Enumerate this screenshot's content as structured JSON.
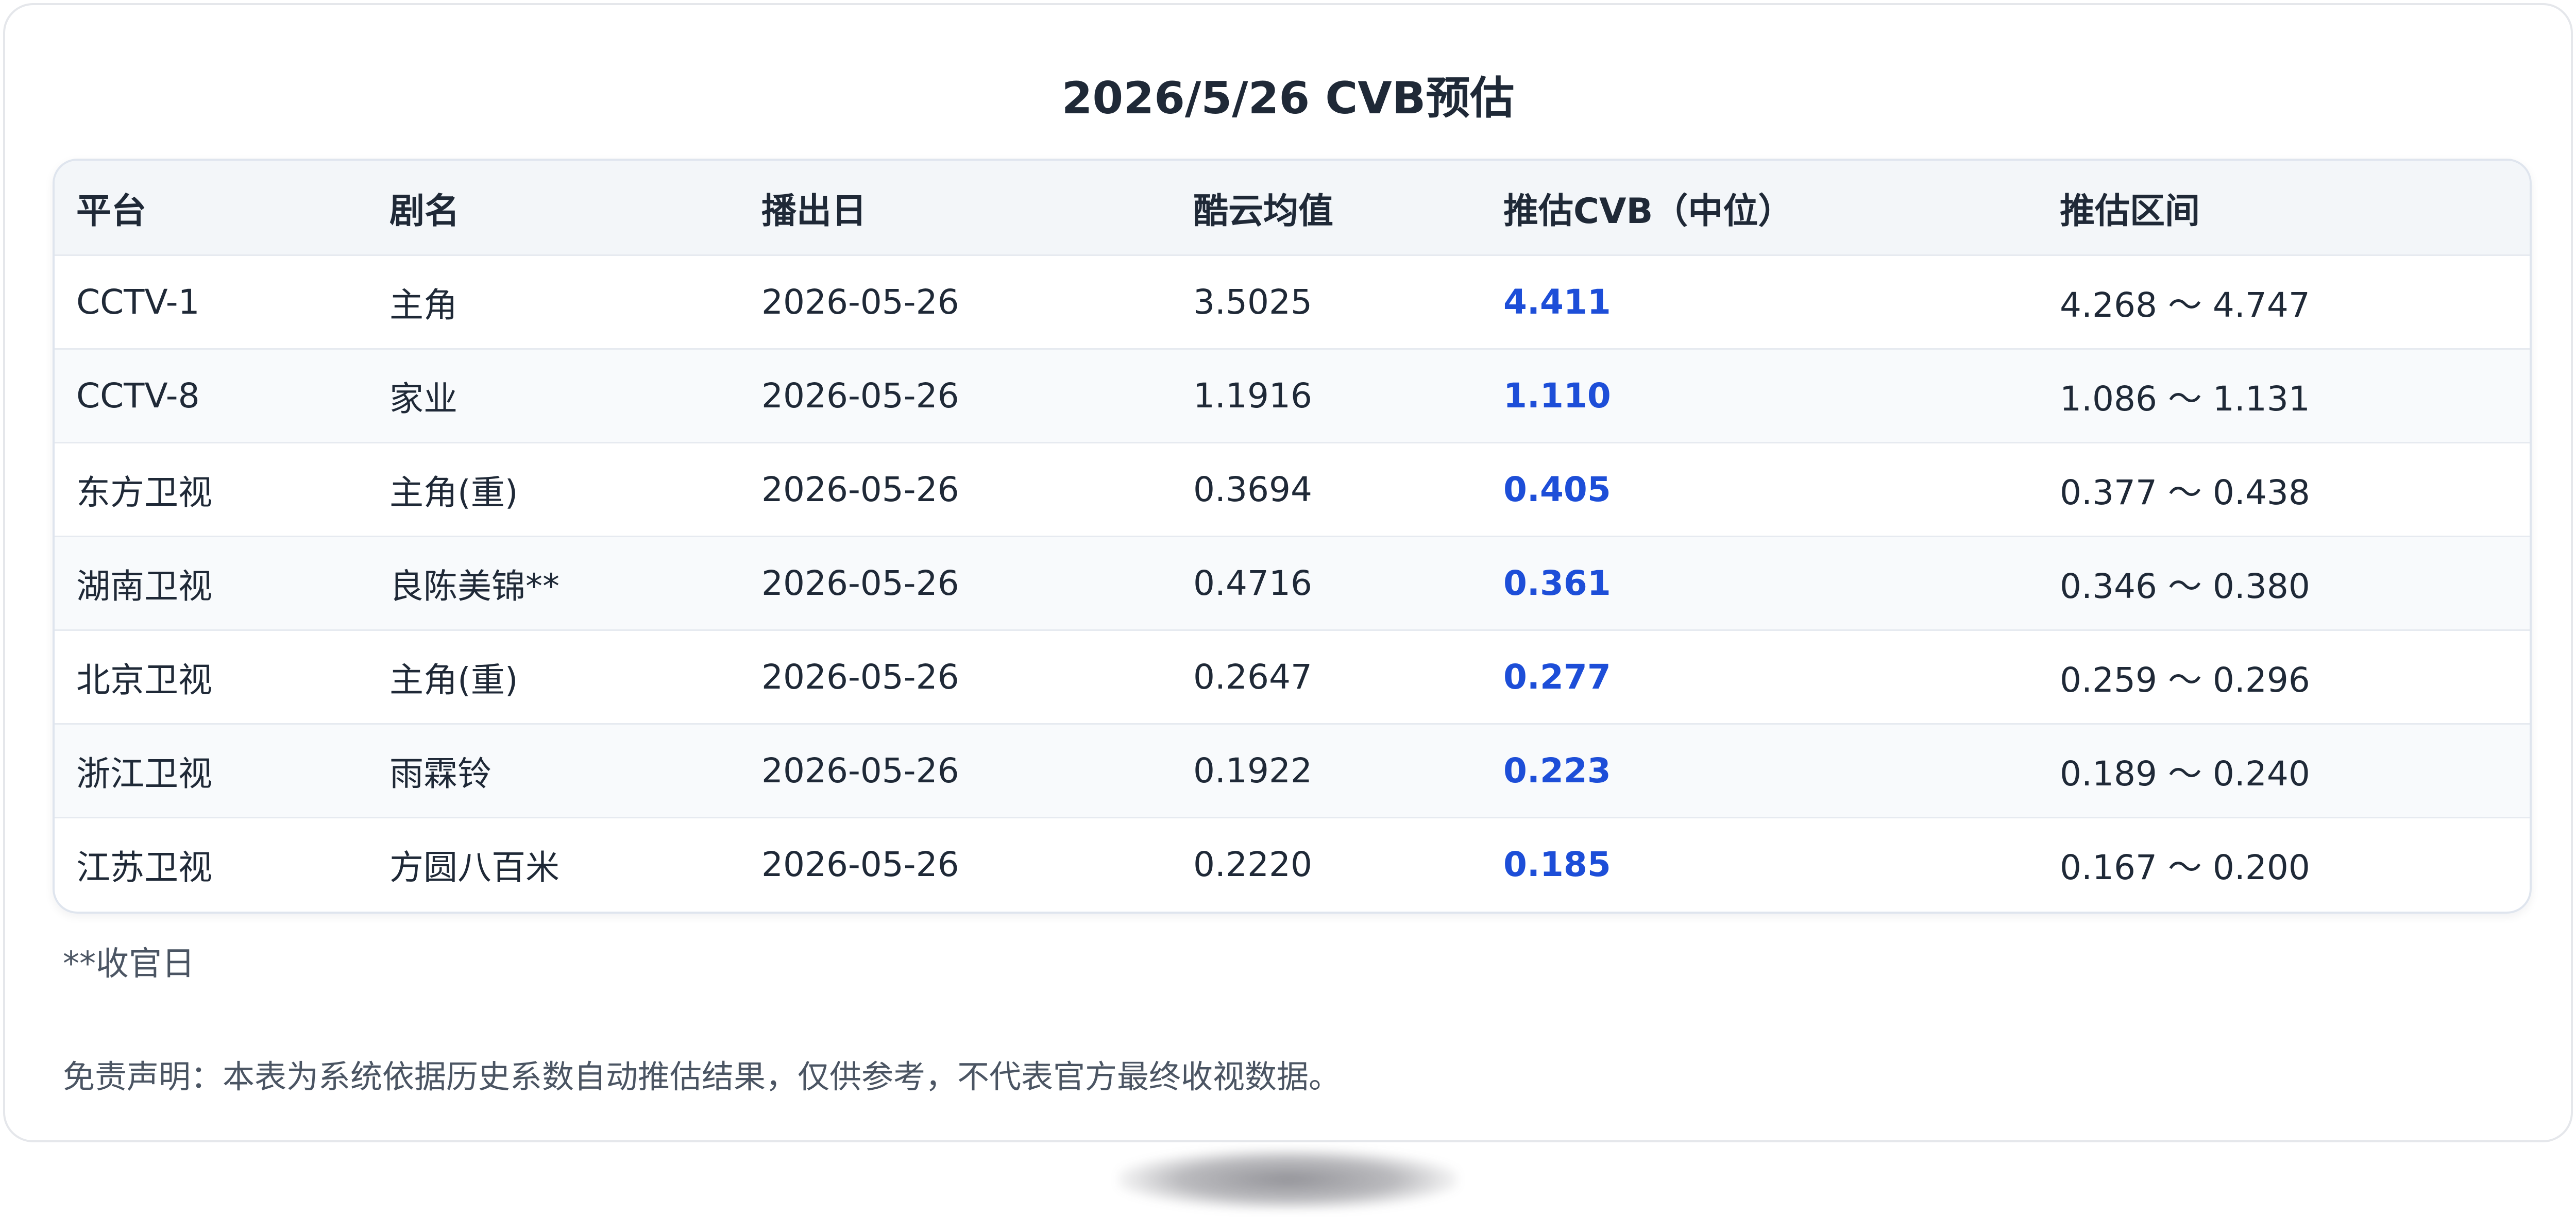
{
  "title": "2026/5/26 CVB预估",
  "table": {
    "headers": [
      "平台",
      "剧名",
      "播出日",
      "酷云均值",
      "推估CVB（中位）",
      "推估区间"
    ],
    "rows": [
      {
        "platform": "CCTV-1",
        "drama": "主角",
        "date": "2026-05-26",
        "kuyun": "3.5025",
        "cvb": "4.411",
        "range": "4.268 ～ 4.747"
      },
      {
        "platform": "CCTV-8",
        "drama": "家业",
        "date": "2026-05-26",
        "kuyun": "1.1916",
        "cvb": "1.110",
        "range": "1.086 ～ 1.131"
      },
      {
        "platform": "东方卫视",
        "drama": "主角(重)",
        "date": "2026-05-26",
        "kuyun": "0.3694",
        "cvb": "0.405",
        "range": "0.377 ～ 0.438"
      },
      {
        "platform": "湖南卫视",
        "drama": "良陈美锦**",
        "date": "2026-05-26",
        "kuyun": "0.4716",
        "cvb": "0.361",
        "range": "0.346 ～ 0.380"
      },
      {
        "platform": "北京卫视",
        "drama": "主角(重)",
        "date": "2026-05-26",
        "kuyun": "0.2647",
        "cvb": "0.277",
        "range": "0.259 ～ 0.296"
      },
      {
        "platform": "浙江卫视",
        "drama": "雨霖铃",
        "date": "2026-05-26",
        "kuyun": "0.1922",
        "cvb": "0.223",
        "range": "0.189 ～ 0.240"
      },
      {
        "platform": "江苏卫视",
        "drama": "方圆八百米",
        "date": "2026-05-26",
        "kuyun": "0.2220",
        "cvb": "0.185",
        "range": "0.167 ～ 0.200"
      }
    ]
  },
  "note": "**收官日",
  "disclaimer": "免责声明：本表为系统依据历史系数自动推估结果，仅供参考，不代表官方最终收视数据。",
  "colors": {
    "accent_blue": "#1d4ed8",
    "text": "#1f2937",
    "muted": "#4b5563",
    "header_bg": "#f3f6f9",
    "alt_row_bg": "#f8fafc"
  }
}
